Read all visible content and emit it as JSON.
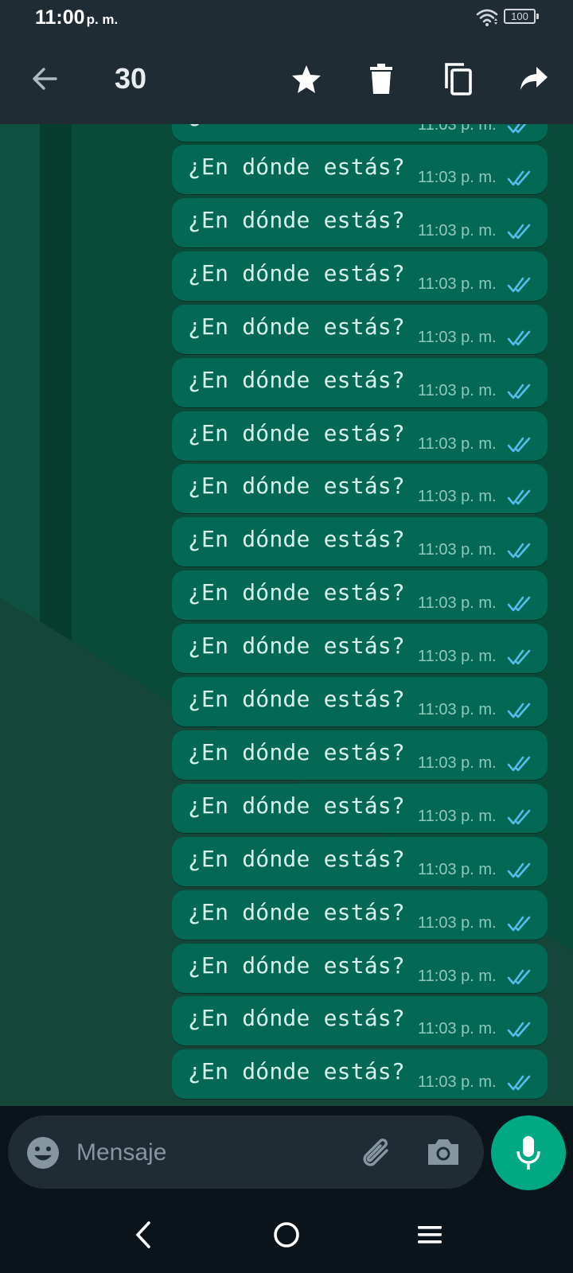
{
  "status_bar": {
    "time": "11:00",
    "ampm": "p. m.",
    "battery": "100"
  },
  "header": {
    "selected_count": "30"
  },
  "messages": {
    "text": "¿En dónde estás?",
    "time": "11:03 p. m.",
    "partial_time": "11:03 p. m."
  },
  "input": {
    "placeholder": "Mensaje",
    "value": ""
  },
  "colors": {
    "header_bg": "#1f2c34",
    "bubble_bg": "#036955",
    "read_ticks": "#53bdeb",
    "mic_button": "#00a884"
  }
}
